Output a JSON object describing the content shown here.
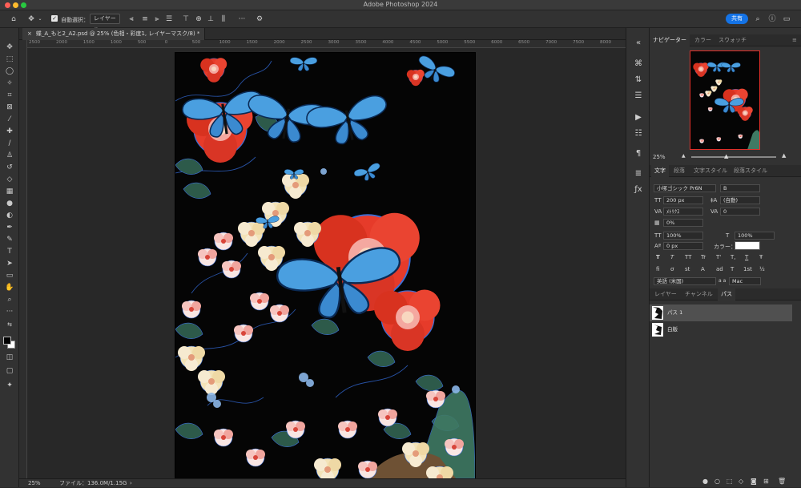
{
  "window": {
    "title": "Adobe Photoshop 2024"
  },
  "options_bar": {
    "auto_select_label": "自動選択：",
    "auto_select_target": "レイヤー",
    "share_label": "共有"
  },
  "document_tab": {
    "label": "蝶_A_もと2_A2.psd @ 25% (色相・彩度1, レイヤーマスク/8) *"
  },
  "ruler": {
    "h_ticks": [
      "2500",
      "2000",
      "1500",
      "1000",
      "500",
      "0",
      "500",
      "1000",
      "1500",
      "2000",
      "2500",
      "3000",
      "3500",
      "4000",
      "4500",
      "5000",
      "5500",
      "6000",
      "6500",
      "7000",
      "7500",
      "8000"
    ]
  },
  "status": {
    "zoom": "25%",
    "file_info": "ファイル：136.0M/1.15G"
  },
  "navigator": {
    "tabs": [
      "ナビゲーター",
      "カラー",
      "スウォッチ"
    ],
    "zoom": "25%"
  },
  "character": {
    "tabs": [
      "文字",
      "段落",
      "文字スタイル",
      "段落スタイル"
    ],
    "font_family": "小塚ゴシック Pr6N",
    "font_style": "B",
    "font_size": "200 px",
    "leading": "(自動)",
    "kerning": "ﾒﾄﾘｸｽ",
    "tracking": "0",
    "tsume": "0%",
    "vertical_scale": "100%",
    "horizontal_scale": "100%",
    "baseline_shift": "0 px",
    "color_label": "カラー：",
    "language": "英語 (米国)",
    "aa_label": "a a",
    "antialias": "Mac",
    "style_buttons": [
      "T",
      "T",
      "TT",
      "Tr",
      "T'",
      "T,",
      "T",
      "Ŧ"
    ],
    "opentype_buttons": [
      "fi",
      "ơ",
      "st",
      "A",
      "ad",
      "T",
      "1st",
      "½"
    ]
  },
  "paths_panel": {
    "tabs": [
      "レイヤー",
      "チャンネル",
      "パス"
    ],
    "items": [
      {
        "name": "パス 1"
      },
      {
        "name": "白版"
      }
    ]
  },
  "colors": {
    "accent": "#1473e6",
    "flower_red": "#e63b2a",
    "butterfly_blue": "#4a9fe0",
    "cream": "#f3e3b8",
    "leaf_green": "#2d5a4a"
  }
}
